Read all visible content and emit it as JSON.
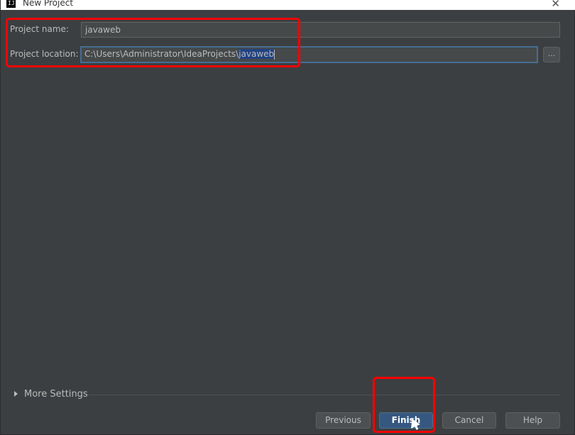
{
  "window": {
    "title": "New Project",
    "icon": "intellij-icon",
    "icon_text": "IJ",
    "close_glyph": "✕"
  },
  "form": {
    "project_name_label": "Project name:",
    "project_name_value": "javaweb",
    "project_location_label": "Project location:",
    "project_location_prefix": "C:\\Users\\Administrator\\IdeaProjects\\",
    "project_location_selected": "javaweb",
    "browse_label": "..."
  },
  "more_settings": {
    "label": "More Settings",
    "expanded": false
  },
  "buttons": {
    "previous": "Previous",
    "finish": "Finish",
    "cancel": "Cancel",
    "help": "Help"
  },
  "colors": {
    "background": "#3c3f41",
    "annotation": "#ff0000",
    "primary_button": "#365880",
    "selection": "#214283"
  }
}
